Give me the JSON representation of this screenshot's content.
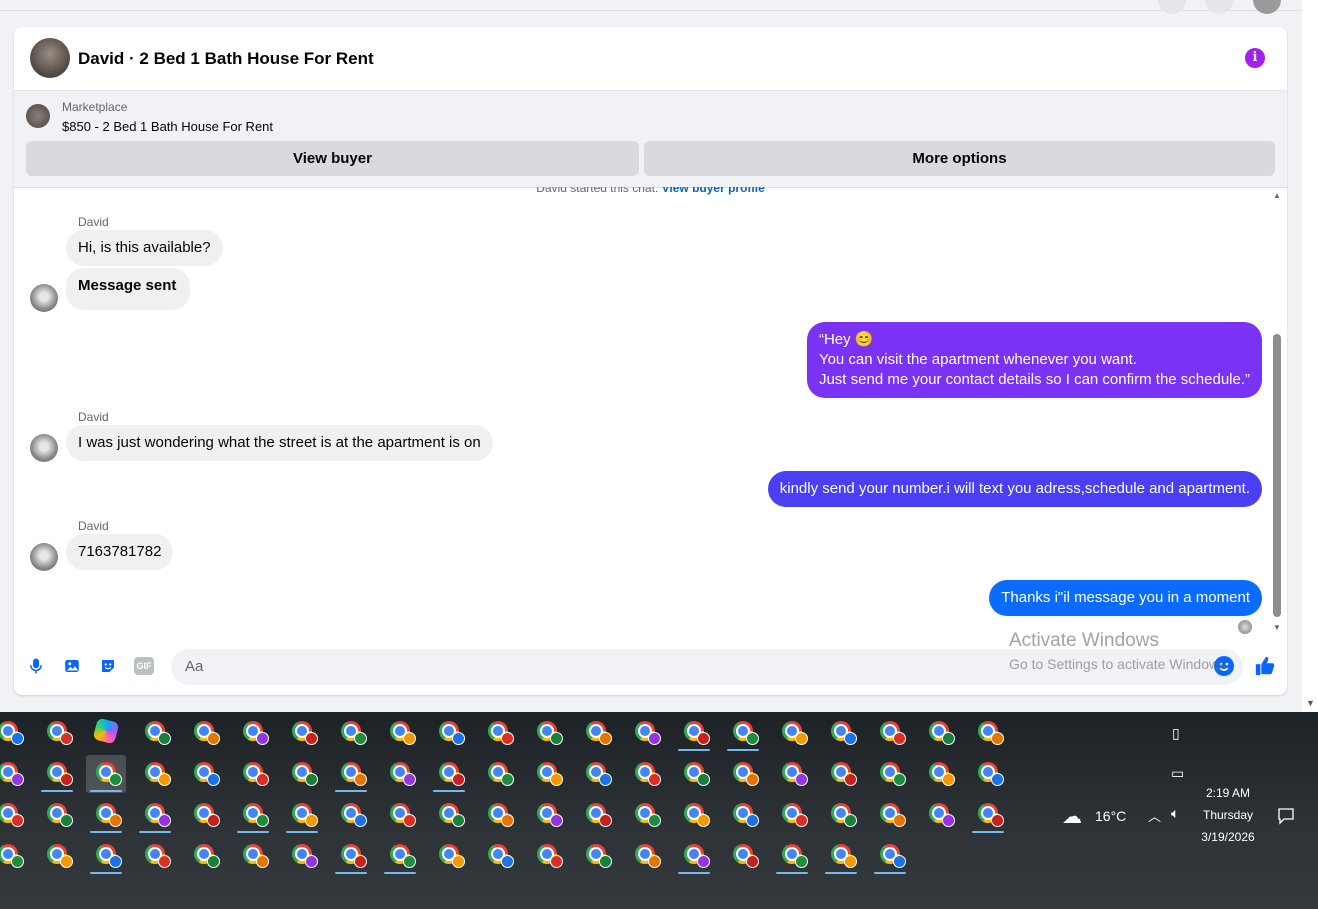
{
  "conversation": {
    "title": "David · 2 Bed 1 Bath House For Rent"
  },
  "marketplace": {
    "label": "Marketplace",
    "item": "$850 - 2 Bed 1 Bath House For Rent",
    "view_buyer": "View buyer",
    "more_options": "More options"
  },
  "chat": {
    "started_text": "David started this chat.",
    "started_link": "View buyer profile",
    "messages": [
      {
        "from": "David",
        "side": "in",
        "text": "Hi, is this available?"
      },
      {
        "from": "David",
        "side": "in",
        "text": "Message sent"
      },
      {
        "from": "me",
        "side": "out",
        "color": "#7a32f5",
        "lines": [
          "“Hey 😊",
          "You can visit the apartment whenever you want.",
          "Just send me your contact details so I can confirm the schedule.”"
        ]
      },
      {
        "from": "David",
        "side": "in",
        "text": "I was just wondering what the street is at the apartment is on"
      },
      {
        "from": "me",
        "side": "out",
        "color": "#4a3ff5",
        "text": "kindly send your number.i will text you adress,schedule and apartment."
      },
      {
        "from": "David",
        "side": "in",
        "text": "7163781782"
      },
      {
        "from": "me",
        "side": "out",
        "color": "#0a6cff",
        "text": "Thanks i\"il message you in a moment"
      }
    ]
  },
  "composer": {
    "placeholder": "Aa",
    "icons": [
      "microphone-icon",
      "photo-icon",
      "sticker-icon",
      "gif-icon",
      "emoji-icon",
      "like-icon"
    ],
    "gif_label": "GIF"
  },
  "watermark": {
    "line1": "Activate Windows",
    "line2": "Go to Settings to activate Windows."
  },
  "taskbar": {
    "weather": "16°C",
    "time": "2:19 AM",
    "day": "Thursday",
    "date": "3/19/2026"
  },
  "colors": {
    "accent": "#0866ff",
    "info": "#a020f0"
  }
}
